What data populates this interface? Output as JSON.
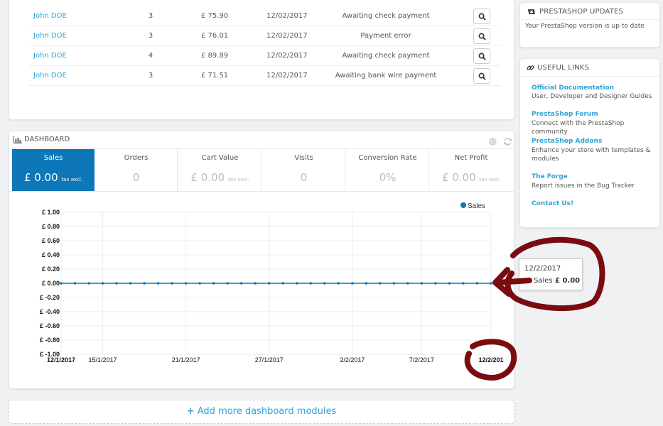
{
  "orders": [
    {
      "customer": "John DOE",
      "quantity": "3",
      "total": "£ 75.90",
      "date": "12/02/2017",
      "status": "Awaiting check payment"
    },
    {
      "customer": "John DOE",
      "quantity": "3",
      "total": "£ 76.01",
      "date": "12/02/2017",
      "status": "Payment error"
    },
    {
      "customer": "John DOE",
      "quantity": "4",
      "total": "£ 89.89",
      "date": "12/02/2017",
      "status": "Awaiting check payment"
    },
    {
      "customer": "John DOE",
      "quantity": "3",
      "total": "£ 71.51",
      "date": "12/02/2017",
      "status": "Awaiting bank wire payment"
    }
  ],
  "dashboard": {
    "title": "DASHBOARD",
    "kpis": [
      {
        "label": "Sales",
        "value": "£ 0.00",
        "suffix": "tax excl.",
        "active": true
      },
      {
        "label": "Orders",
        "value": "0",
        "suffix": "",
        "active": false
      },
      {
        "label": "Cart Value",
        "value": "£ 0.00",
        "suffix": "tax excl.",
        "active": false
      },
      {
        "label": "Visits",
        "value": "0",
        "suffix": "",
        "active": false
      },
      {
        "label": "Conversion Rate",
        "value": "0%",
        "suffix": "",
        "active": false
      },
      {
        "label": "Net Profit",
        "value": "£ 0.00",
        "suffix": "tax excl.",
        "active": false
      }
    ]
  },
  "chart_data": {
    "type": "line",
    "title": "",
    "xlabel": "",
    "ylabel": "",
    "ylim": [
      -1,
      1
    ],
    "y_ticks": [
      "£ 1.00",
      "£ 0.80",
      "£ 0.60",
      "£ 0.40",
      "£ 0.20",
      "£ 0.00",
      "£ -0.20",
      "£ -0.40",
      "£ -0.60",
      "£ -0.80",
      "£ -1.00"
    ],
    "x_ticks": [
      "12/1/2017",
      "15/1/2017",
      "21/1/2017",
      "27/1/2017",
      "2/2/2017",
      "7/2/2017",
      "12/2/201"
    ],
    "x_tick_days": [
      0,
      3,
      9,
      15,
      21,
      26,
      31
    ],
    "x_days": [
      0,
      1,
      2,
      3,
      4,
      5,
      6,
      7,
      8,
      9,
      10,
      11,
      12,
      13,
      14,
      15,
      16,
      17,
      18,
      19,
      20,
      21,
      22,
      23,
      24,
      25,
      26,
      27,
      28,
      29,
      30,
      31
    ],
    "grid": true,
    "legend": "top-right",
    "series": [
      {
        "name": "Sales",
        "color": "#0d77b8",
        "values": [
          0,
          0,
          0,
          0,
          0,
          0,
          0,
          0,
          0,
          0,
          0,
          0,
          0,
          0,
          0,
          0,
          0,
          0,
          0,
          0,
          0,
          0,
          0,
          0,
          0,
          0,
          0,
          0,
          0,
          0,
          0,
          0
        ]
      }
    ]
  },
  "tooltip": {
    "date": "12/2/2017",
    "series": "Sales",
    "value": "£ 0.00"
  },
  "add_more": "Add more dashboard modules",
  "updates": {
    "title": "PRESTASHOP UPDATES",
    "text": "Your PrestaShop version is up to date"
  },
  "links": {
    "title": "USEFUL LINKS",
    "items": [
      {
        "title": "Official Documentation",
        "desc": "User, Developer and Designer Guides"
      },
      {
        "title": "PrestaShop Forum",
        "desc": "Connect with the PrestaShop community"
      },
      {
        "title": "PrestaShop Addons",
        "desc": "Enhance your store with templates & modules"
      },
      {
        "title": "The Forge",
        "desc": "Report issues in the Bug Tracker"
      },
      {
        "title": "Contact Us!",
        "desc": ""
      }
    ]
  },
  "colors": {
    "accent": "#0d77b8",
    "link": "#2ea4d6",
    "annotation": "#7a0c10"
  }
}
